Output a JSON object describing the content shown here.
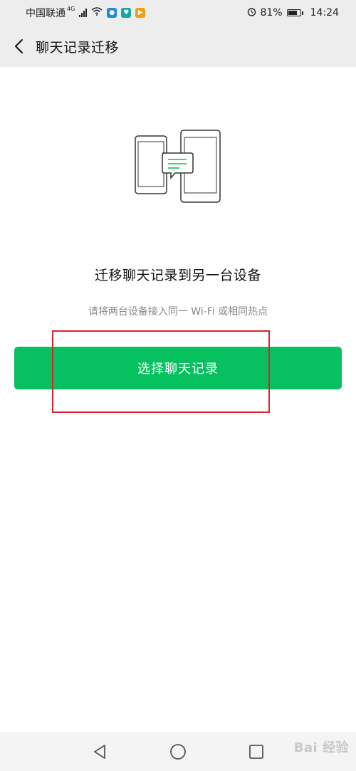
{
  "status_bar": {
    "carrier": "中国联通",
    "network_type": "4G",
    "battery_percent": "81%",
    "battery_level": 0.81,
    "time": "14:24",
    "icons": [
      "signal-icon",
      "wifi-icon",
      "app-badge-blue-icon",
      "app-badge-teal-icon",
      "app-badge-orange-icon",
      "alarm-icon",
      "battery-icon"
    ]
  },
  "nav": {
    "title": "聊天记录迁移",
    "back_icon": "chevron-left-icon"
  },
  "main": {
    "illustration_icon": "phone-to-tablet-transfer-icon",
    "headline": "迁移聊天记录到另一台设备",
    "subtext": "请将两台设备接入同一 Wi-Fi 或相同热点",
    "primary_button_label": "选择聊天记录"
  },
  "colors": {
    "accent": "#07c160",
    "highlight": "#d9232d",
    "header_bg": "#ededed",
    "subtext": "#888888"
  },
  "system_nav": {
    "icons": [
      "back-triangle-icon",
      "home-circle-icon",
      "recents-square-icon"
    ]
  },
  "watermark": {
    "text": "Bai 经验"
  }
}
